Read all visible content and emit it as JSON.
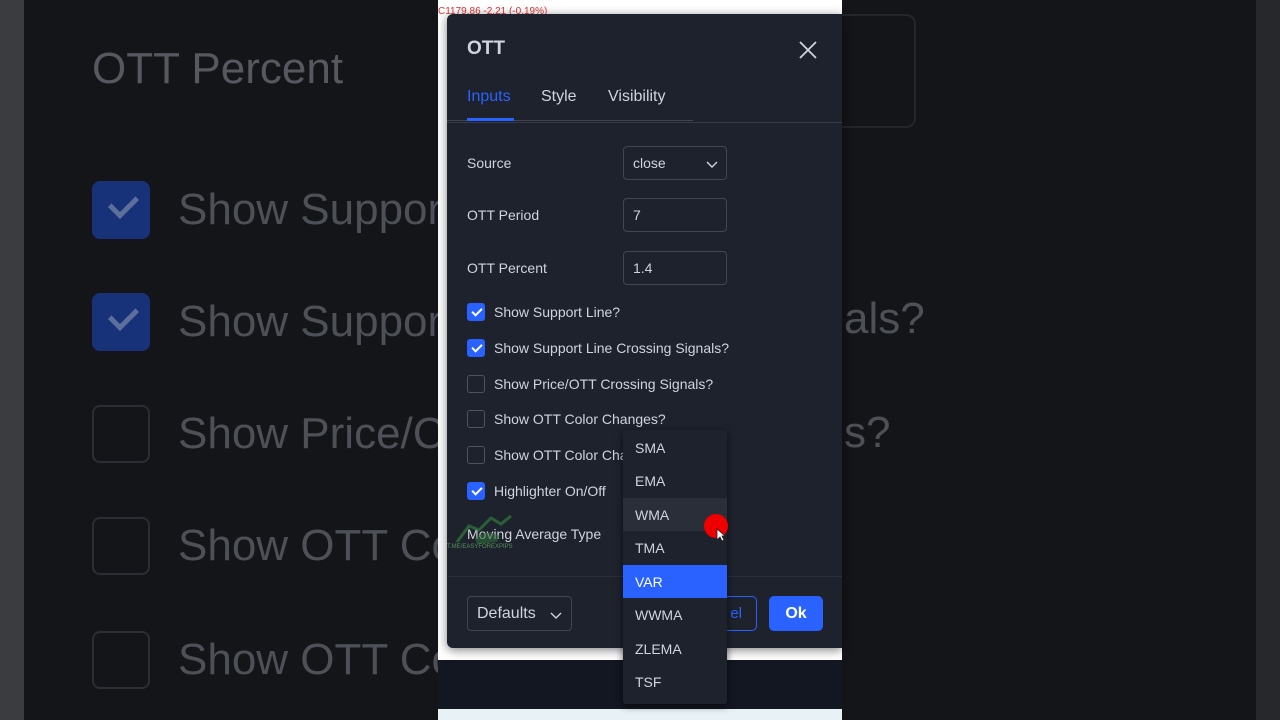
{
  "price_readout": "C1179.86 -2.21 (-0.19%)",
  "background": {
    "title": "OTT Percent",
    "rows": [
      {
        "text": "Show Suppor",
        "checked": true
      },
      {
        "text": "Show Suppor",
        "checked": true
      },
      {
        "text": "Show Price/C",
        "checked": false
      },
      {
        "text": "Show OTT Co",
        "checked": false
      },
      {
        "text": "Show OTT Co",
        "checked": false
      }
    ],
    "right_fragments": [
      "als?",
      "s?"
    ]
  },
  "dialog": {
    "title": "OTT",
    "tabs": [
      {
        "label": "Inputs",
        "active": true
      },
      {
        "label": "Style",
        "active": false
      },
      {
        "label": "Visibility",
        "active": false
      }
    ],
    "source": {
      "label": "Source",
      "value": "close"
    },
    "period": {
      "label": "OTT Period",
      "value": "7"
    },
    "percent": {
      "label": "OTT Percent",
      "value": "1.4"
    },
    "checkboxes": [
      {
        "label": "Show Support Line?",
        "checked": true
      },
      {
        "label": "Show Support Line Crossing Signals?",
        "checked": true
      },
      {
        "label": "Show Price/OTT Crossing Signals?",
        "checked": false
      },
      {
        "label": "Show OTT Color Changes?",
        "checked": false
      },
      {
        "label": "Show OTT Color Cha",
        "checked": false
      },
      {
        "label": "Highlighter On/Off",
        "checked": true
      }
    ],
    "ma_type_label": "Moving Average Type",
    "watermark": "T.ME/EASYFOREXPIPS",
    "defaults_label": "Defaults",
    "cancel_label": "el",
    "ok_label": "Ok"
  },
  "ma_dropdown": {
    "options": [
      "SMA",
      "EMA",
      "WMA",
      "TMA",
      "VAR",
      "WWMA",
      "ZLEMA",
      "TSF"
    ],
    "selected": "VAR",
    "hovered": "WMA"
  },
  "colors": {
    "accent": "#2962ff",
    "dialog_bg": "#1e222d",
    "text": "#d1d4dc",
    "cursor_highlight": "#ee0000"
  }
}
